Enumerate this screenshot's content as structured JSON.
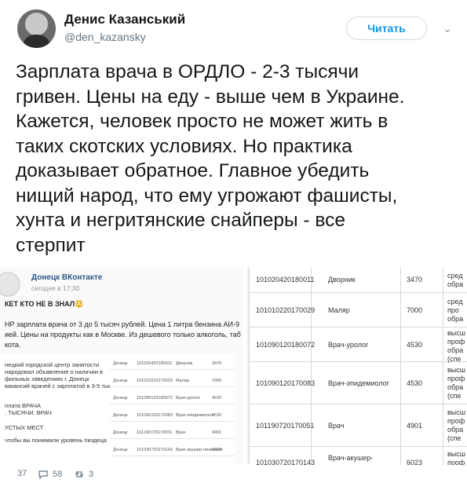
{
  "author": {
    "display_name": "Денис Казанський",
    "handle": "@den_kazansky"
  },
  "follow_button": {
    "label": "Читать"
  },
  "tweet": {
    "text": "Зарплата врача в ОРДЛО - 2-3 тысячи\nгривен. Цены на еду - выше чем в Украине.\nКажется, человек просто не может жить в\nтаких скотских условиях. Но практика\nдоказывает обратное. Главное убедить\nнищий народ, что ему угрожают фашисты,\nхунта и негритянские снайперы - все\nстерпит"
  },
  "media_left": {
    "source_title": "Донецк ВКонтакте",
    "source_time": "сегодня в 17:30",
    "lines": [
      "КЕТ КТО НЕ В ЗНАЛ😳",
      "НР зарплата врача от 3 до 5 тысяч рублей. Цена 1 литра бензина АИ-9",
      "ией. Цены на продукты как в Москве. Из дешевого только алкоголь, таб",
      "кота."
    ],
    "doc_lines": [
      "нецкий городской центр занятости",
      "народовал объявление о наличии в",
      "фильных заведениях г. Донецк",
      "вакансий врачей с зарплатой в 3-5 тыс.",
      "",
      "плата ВРАЧА",
      ". ТЫСЯЧИ. ВРАЧ",
      "УСТЫХ МЕСТ",
      "чтобы вы понимали уровень пиздеца"
    ],
    "mini_rows": [
      [
        "Донецк",
        "101020420180011",
        "Дворник",
        "3470"
      ],
      [
        "Донецк",
        "101010220170029",
        "Маляр",
        "7000"
      ],
      [
        "Донецк",
        "101090120180072",
        "Врач-уролог",
        "4530"
      ],
      [
        "Донецк",
        "101090120170083",
        "Врач-эпидемиолог",
        "4530"
      ],
      [
        "Донецк",
        "101190720170051",
        "Врач",
        "4901"
      ],
      [
        "Донецк",
        "101030720170143",
        "Врач-акушер-гинеколог",
        "6023"
      ]
    ]
  },
  "media_right": {
    "rows": [
      {
        "code": "101020420180011",
        "position": "Дворник",
        "salary": "3470",
        "edu": "сред\nобра"
      },
      {
        "code": "101010220170029",
        "position": "Маляр",
        "salary": "7000",
        "edu": "сред\nпро\nобра"
      },
      {
        "code": "101090120180072",
        "position": "Врач-уролог",
        "salary": "4530",
        "edu": "высш\nпроф\nобра\n(спе"
      },
      {
        "code": "101090120170083",
        "position": "Врач-эпидемиолог",
        "salary": "4530",
        "edu": "высш\nпроф\nобра\n(спе"
      },
      {
        "code": "101190720170051",
        "position": "Врач",
        "salary": "4901",
        "edu": "высш\nпроф\nобра\n(спе"
      },
      {
        "code": "101030720170143",
        "position": "Врач-акушер-\nгинеколог",
        "salary": "6023",
        "edu": "высш\nпроф\nобра"
      }
    ]
  },
  "actions": {
    "replies": "37",
    "likes": "58",
    "retweets": "3"
  },
  "colors": {
    "accent": "#1b95e0",
    "muted": "#657786",
    "text": "#14171a"
  }
}
